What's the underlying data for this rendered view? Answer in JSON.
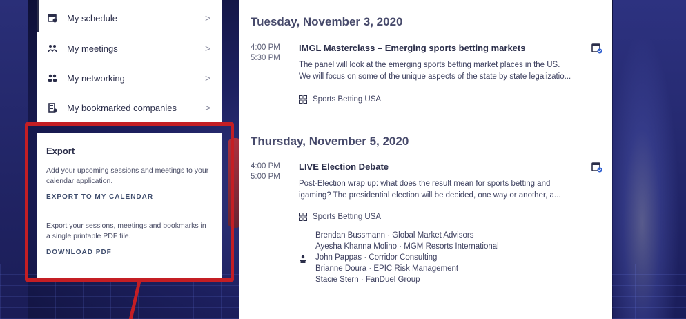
{
  "menu": {
    "items": [
      {
        "label": "My schedule",
        "icon": "calendar-icon"
      },
      {
        "label": "My meetings",
        "icon": "meeting-icon"
      },
      {
        "label": "My networking",
        "icon": "people-icon"
      },
      {
        "label": "My bookmarked companies",
        "icon": "bookmark-company-icon"
      }
    ],
    "chevron": ">"
  },
  "export": {
    "title": "Export",
    "calendar_text": "Add your upcoming sessions and meetings to your calendar application.",
    "calendar_link": "EXPORT TO MY CALENDAR",
    "pdf_text": "Export your sessions, meetings and bookmarks in a single printable PDF file.",
    "pdf_link": "DOWNLOAD PDF"
  },
  "schedule": {
    "days": [
      {
        "heading": "Tuesday, November 3, 2020",
        "session": {
          "start": "4:00 PM",
          "end": "5:30 PM",
          "title": "IMGL Masterclass – Emerging sports betting markets",
          "desc_line1": "The panel will look at the emerging sports betting market places in the US.",
          "desc_line2": "We will focus on some of the unique aspects of the state by state legalizatio...",
          "track": "Sports Betting USA"
        }
      },
      {
        "heading": "Thursday, November 5, 2020",
        "session": {
          "start": "4:00 PM",
          "end": "5:00 PM",
          "title": "LIVE Election Debate",
          "desc_line1": "Post-Election wrap up: what does the result mean for sports betting and",
          "desc_line2": "igaming? The presidential election will be decided, one way or another, a...",
          "track": "Sports Betting USA",
          "speakers": [
            "Brendan Bussmann · Global Market Advisors",
            "Ayesha Khanna Molino · MGM Resorts International",
            "John Pappas · Corridor Consulting",
            "Brianne Doura · EPIC Risk Management",
            "Stacie Stern · FanDuel Group"
          ]
        }
      }
    ]
  },
  "colors": {
    "highlight": "#c41e24",
    "accent_icon": "#2f5fd0",
    "text": "#2b2e4a"
  }
}
